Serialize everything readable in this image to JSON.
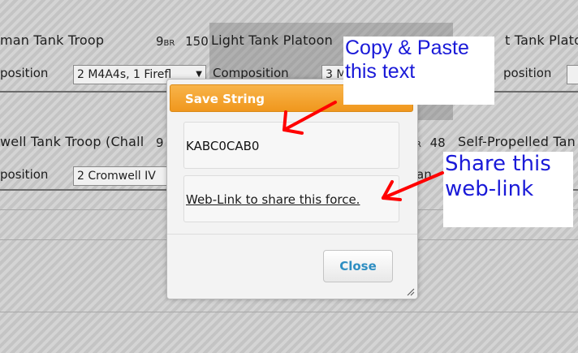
{
  "background": {
    "row1": [
      {
        "title": "man Tank Troop",
        "rating_num": "9",
        "rating_unit": "BR",
        "points": "150",
        "comp_label": "position",
        "comp_value": "2 M4A4s, 1 Firefl"
      },
      {
        "title": "Light Tank Platoon",
        "comp_label": "Composition",
        "comp_value": "3 M"
      },
      {
        "title": "t Tank Platoon",
        "comp_label": "position"
      }
    ],
    "row2": [
      {
        "title": "well Tank Troop (Chall",
        "rating_num": "9",
        "rating_unit": "",
        "comp_label": "position",
        "comp_value": "2 Cromwell IV"
      },
      {
        "rating_unit": "BR",
        "points": "48",
        "comp_value": "an"
      },
      {
        "title": "Self-Propelled Tan"
      }
    ]
  },
  "dialog": {
    "title": "Save String",
    "save_string": "KABC0CAB0",
    "share_link": "Web-Link to share this force.",
    "close_label": "Close"
  },
  "annotations": {
    "copy_note_line1": "Copy & Paste",
    "copy_note_line2": "this text",
    "share_note_line1": "Share this",
    "share_note_line2": "web-link",
    "arrow_color": "#ff0000",
    "text_color": "#1a1ad8"
  },
  "colors": {
    "dialog_header": "#f0971d",
    "close_text": "#2e8ec2"
  }
}
